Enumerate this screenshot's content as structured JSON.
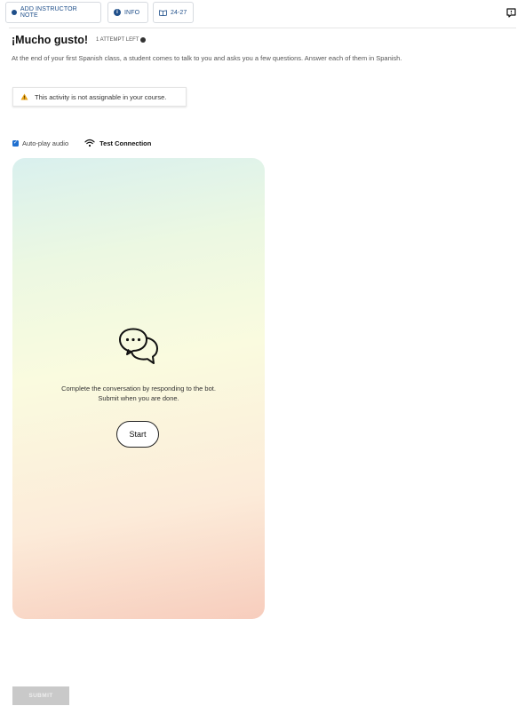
{
  "toolbar": {
    "add_note_label": "ADD INSTRUCTOR NOTE",
    "add_note_icon": "circle-icon",
    "info_label": "INFO",
    "info_icon": "info-icon",
    "pages_label": "24-27",
    "pages_icon": "book-open-icon",
    "feedback_icon": "feedback-icon"
  },
  "activity": {
    "title": "¡Mucho gusto!",
    "attempts": "1 ATTEMPT LEFT",
    "attempts_icon": "help-icon",
    "description": "At the end of your first Spanish class, a student comes to talk to you and asks you a few questions. Answer each of them in Spanish."
  },
  "alert": {
    "icon": "warning-icon",
    "text": "This activity is not assignable in your course."
  },
  "controls": {
    "autoplay_label": "Auto-play audio",
    "autoplay_checked": true,
    "test_connection_label": "Test Connection",
    "test_connection_icon": "wifi-icon"
  },
  "conversation": {
    "icon": "chat-bubbles-icon",
    "prompt": "Complete the conversation by responding to the bot. Submit when you are done.",
    "start_label": "Start"
  },
  "footer": {
    "submit_label": "SUBMIT"
  },
  "colors": {
    "accent": "#1f4f8a",
    "checkbox": "#1f6fd0",
    "gradient_top": "#d9f0ee",
    "gradient_mid": "#fafbdf",
    "gradient_bottom": "#f7cdbd",
    "submit_disabled": "#c9c9c9"
  }
}
